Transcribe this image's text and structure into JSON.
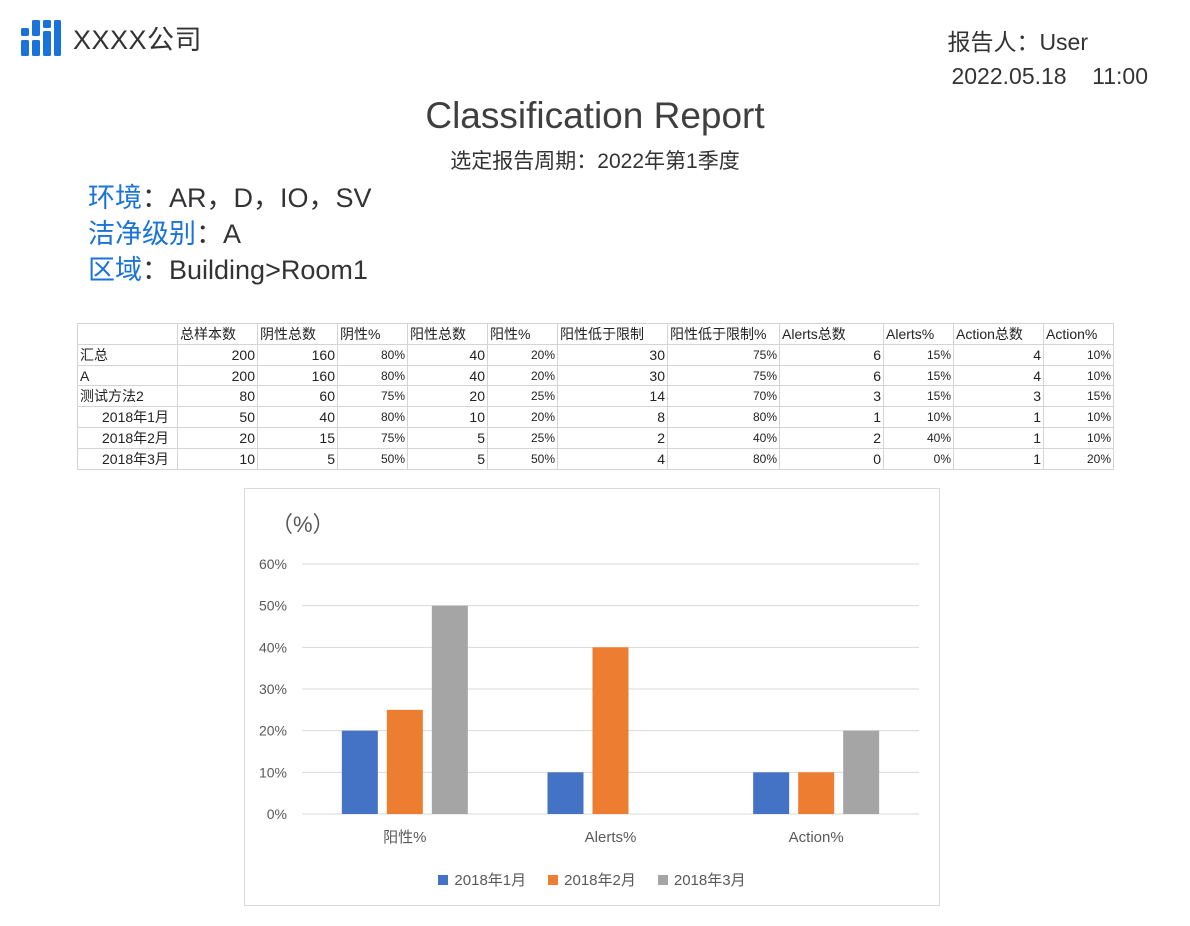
{
  "header": {
    "company": "XXXX公司",
    "reporter": "报告人：User",
    "datetime": "2022.05.18    11:00"
  },
  "report": {
    "title": "Classification Report",
    "period": "选定报告周期：2022年第1季度"
  },
  "filters": [
    {
      "label": "环境",
      "value": "：AR，D，IO，SV"
    },
    {
      "label": "洁净级别",
      "value": "：A"
    },
    {
      "label": "区域",
      "value": "：Building>Room1"
    }
  ],
  "table": {
    "columns": [
      "",
      "总样本数",
      "阴性总数",
      "阴性%",
      "阳性总数",
      "阳性%",
      "阳性低于限制",
      "阳性低于限制%",
      "Alerts总数",
      "Alerts%",
      "Action总数",
      "Action%"
    ],
    "rows": [
      {
        "label": "汇总",
        "indent": false,
        "cells": [
          "200",
          "160",
          "80%",
          "40",
          "20%",
          "30",
          "75%",
          "6",
          "15%",
          "4",
          "10%"
        ]
      },
      {
        "label": "A",
        "indent": false,
        "cells": [
          "200",
          "160",
          "80%",
          "40",
          "20%",
          "30",
          "75%",
          "6",
          "15%",
          "4",
          "10%"
        ]
      },
      {
        "label": "测试方法2",
        "indent": false,
        "cells": [
          "80",
          "60",
          "75%",
          "20",
          "25%",
          "14",
          "70%",
          "3",
          "15%",
          "3",
          "15%"
        ]
      },
      {
        "label": "2018年1月",
        "indent": true,
        "cells": [
          "50",
          "40",
          "80%",
          "10",
          "20%",
          "8",
          "80%",
          "1",
          "10%",
          "1",
          "10%"
        ]
      },
      {
        "label": "2018年2月",
        "indent": true,
        "cells": [
          "20",
          "15",
          "75%",
          "5",
          "25%",
          "2",
          "40%",
          "2",
          "40%",
          "1",
          "10%"
        ]
      },
      {
        "label": "2018年3月",
        "indent": true,
        "cells": [
          "10",
          "5",
          "50%",
          "5",
          "50%",
          "4",
          "80%",
          "0",
          "0%",
          "1",
          "20%"
        ]
      }
    ]
  },
  "chart_data": {
    "type": "bar",
    "unit_label": "（%）",
    "categories": [
      "阳性%",
      "Alerts%",
      "Action%"
    ],
    "series": [
      {
        "name": "2018年1月",
        "color": "#4472c4",
        "values": [
          20,
          10,
          10
        ]
      },
      {
        "name": "2018年2月",
        "color": "#ed7d31",
        "values": [
          25,
          40,
          10
        ]
      },
      {
        "name": "2018年3月",
        "color": "#a5a5a5",
        "values": [
          50,
          0,
          20
        ]
      }
    ],
    "yticks": [
      "0%",
      "10%",
      "20%",
      "30%",
      "40%",
      "50%",
      "60%"
    ],
    "ylim": [
      0,
      60
    ],
    "grid": true,
    "legend": "bottom"
  }
}
